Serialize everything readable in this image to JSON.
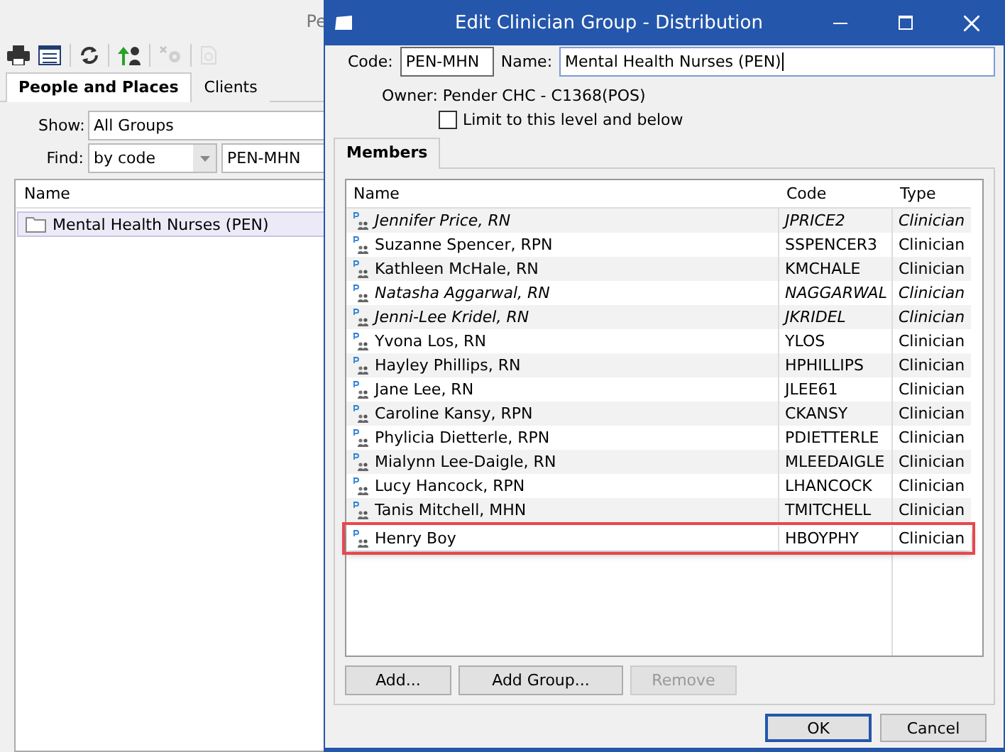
{
  "background_window": {
    "title": "Pe",
    "toolbar": [
      {
        "kind": "print",
        "disabled": false
      },
      {
        "kind": "calendar",
        "disabled": false
      },
      {
        "kind": "refresh",
        "disabled": false
      },
      {
        "kind": "promote",
        "disabled": false
      },
      {
        "kind": "unpin",
        "disabled": true
      },
      {
        "kind": "document",
        "disabled": true
      }
    ],
    "tabs": [
      {
        "label": "People and Places",
        "selected": true
      },
      {
        "label": "Clients",
        "selected": false
      }
    ],
    "show": {
      "label": "Show:",
      "value": "All Groups"
    },
    "find": {
      "label": "Find:",
      "mode": "by code",
      "value": "PEN-MHN"
    },
    "list": {
      "column": "Name",
      "rows": [
        {
          "label": "Mental Health Nurses (PEN)",
          "selected": true
        }
      ]
    }
  },
  "dialog": {
    "title": "Edit Clinician Group - Distribution",
    "code": {
      "label": "Code:",
      "value": "PEN-MHN"
    },
    "name": {
      "label": "Name:",
      "value": "Mental Health Nurses (PEN)"
    },
    "owner": "Owner: Pender CHC - C1368(POS)",
    "limit": {
      "label": "Limit to this level and below",
      "checked": false
    },
    "tabs": [
      {
        "label": "Members",
        "selected": true
      }
    ],
    "members": {
      "columns": [
        "Name",
        "Code",
        "Type"
      ],
      "rows": [
        {
          "name": "Jennifer Price, RN",
          "code": "JPRICE2",
          "type": "Clinician",
          "italic": true,
          "highlighted": false
        },
        {
          "name": "Suzanne Spencer, RPN",
          "code": "SSPENCER3",
          "type": "Clinician",
          "italic": false,
          "highlighted": false
        },
        {
          "name": "Kathleen McHale, RN",
          "code": "KMCHALE",
          "type": "Clinician",
          "italic": false,
          "highlighted": false
        },
        {
          "name": "Natasha Aggarwal, RN",
          "code": "NAGGARWAL",
          "type": "Clinician",
          "italic": true,
          "highlighted": false
        },
        {
          "name": "Jenni-Lee Kridel, RN",
          "code": "JKRIDEL",
          "type": "Clinician",
          "italic": true,
          "highlighted": false
        },
        {
          "name": "Yvona Los, RN",
          "code": "YLOS",
          "type": "Clinician",
          "italic": false,
          "highlighted": false
        },
        {
          "name": "Hayley Phillips, RN",
          "code": "HPHILLIPS",
          "type": "Clinician",
          "italic": false,
          "highlighted": false
        },
        {
          "name": "Jane Lee, RN",
          "code": "JLEE61",
          "type": "Clinician",
          "italic": false,
          "highlighted": false
        },
        {
          "name": "Caroline Kansy, RPN",
          "code": "CKANSY",
          "type": "Clinician",
          "italic": false,
          "highlighted": false
        },
        {
          "name": "Phylicia Dietterle, RPN",
          "code": "PDIETTERLE",
          "type": "Clinician",
          "italic": false,
          "highlighted": false
        },
        {
          "name": "Mialynn Lee-Daigle, RN",
          "code": "MLEEDAIGLE",
          "type": "Clinician",
          "italic": false,
          "highlighted": false
        },
        {
          "name": "Lucy Hancock, RPN",
          "code": "LHANCOCK",
          "type": "Clinician",
          "italic": false,
          "highlighted": false
        },
        {
          "name": "Tanis Mitchell, MHN",
          "code": "TMITCHELL",
          "type": "Clinician",
          "italic": false,
          "highlighted": false
        },
        {
          "name": "Henry Boy",
          "code": "HBOYPHY",
          "type": "Clinician",
          "italic": false,
          "highlighted": true
        }
      ]
    },
    "member_buttons": [
      {
        "label": "Add...",
        "disabled": false
      },
      {
        "label": "Add Group...",
        "disabled": false
      },
      {
        "label": "Remove",
        "disabled": true
      }
    ],
    "buttons": [
      {
        "label": "OK",
        "default": true
      },
      {
        "label": "Cancel",
        "default": false
      }
    ]
  }
}
